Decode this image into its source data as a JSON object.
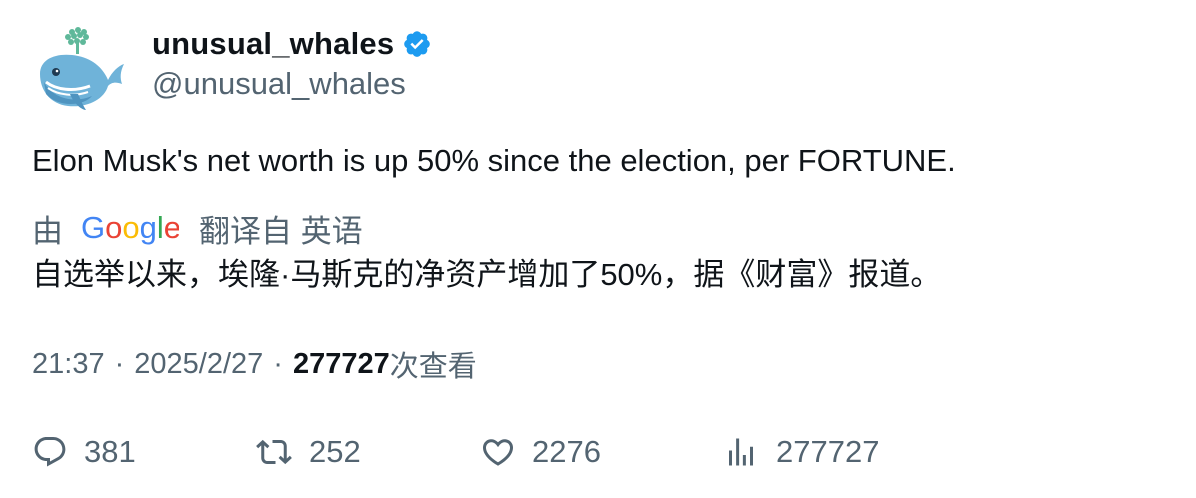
{
  "user": {
    "display_name": "unusual_whales",
    "handle": "@unusual_whales",
    "avatar_icon": "whale-logo-icon",
    "verified_icon": "verified-badge-icon"
  },
  "tweet": {
    "text": "Elon Musk's net worth is up 50% since the election, per FORTUNE.",
    "translation": {
      "by_label": "由",
      "provider_icon": "google-logo-icon",
      "from_label": "翻译自 英语",
      "text": "自选举以来，埃隆·马斯克的净资产增加了50%，据《财富》报道。"
    },
    "time": "21:37",
    "separator": "·",
    "date": "2025/2/27",
    "views_count": "277727",
    "views_label": "次查看"
  },
  "actions": {
    "replies": "381",
    "retweets": "252",
    "likes": "2276",
    "views": "277727"
  },
  "colors": {
    "text": "#0f1419",
    "secondary": "#536471",
    "verified": "#1d9bf0"
  }
}
